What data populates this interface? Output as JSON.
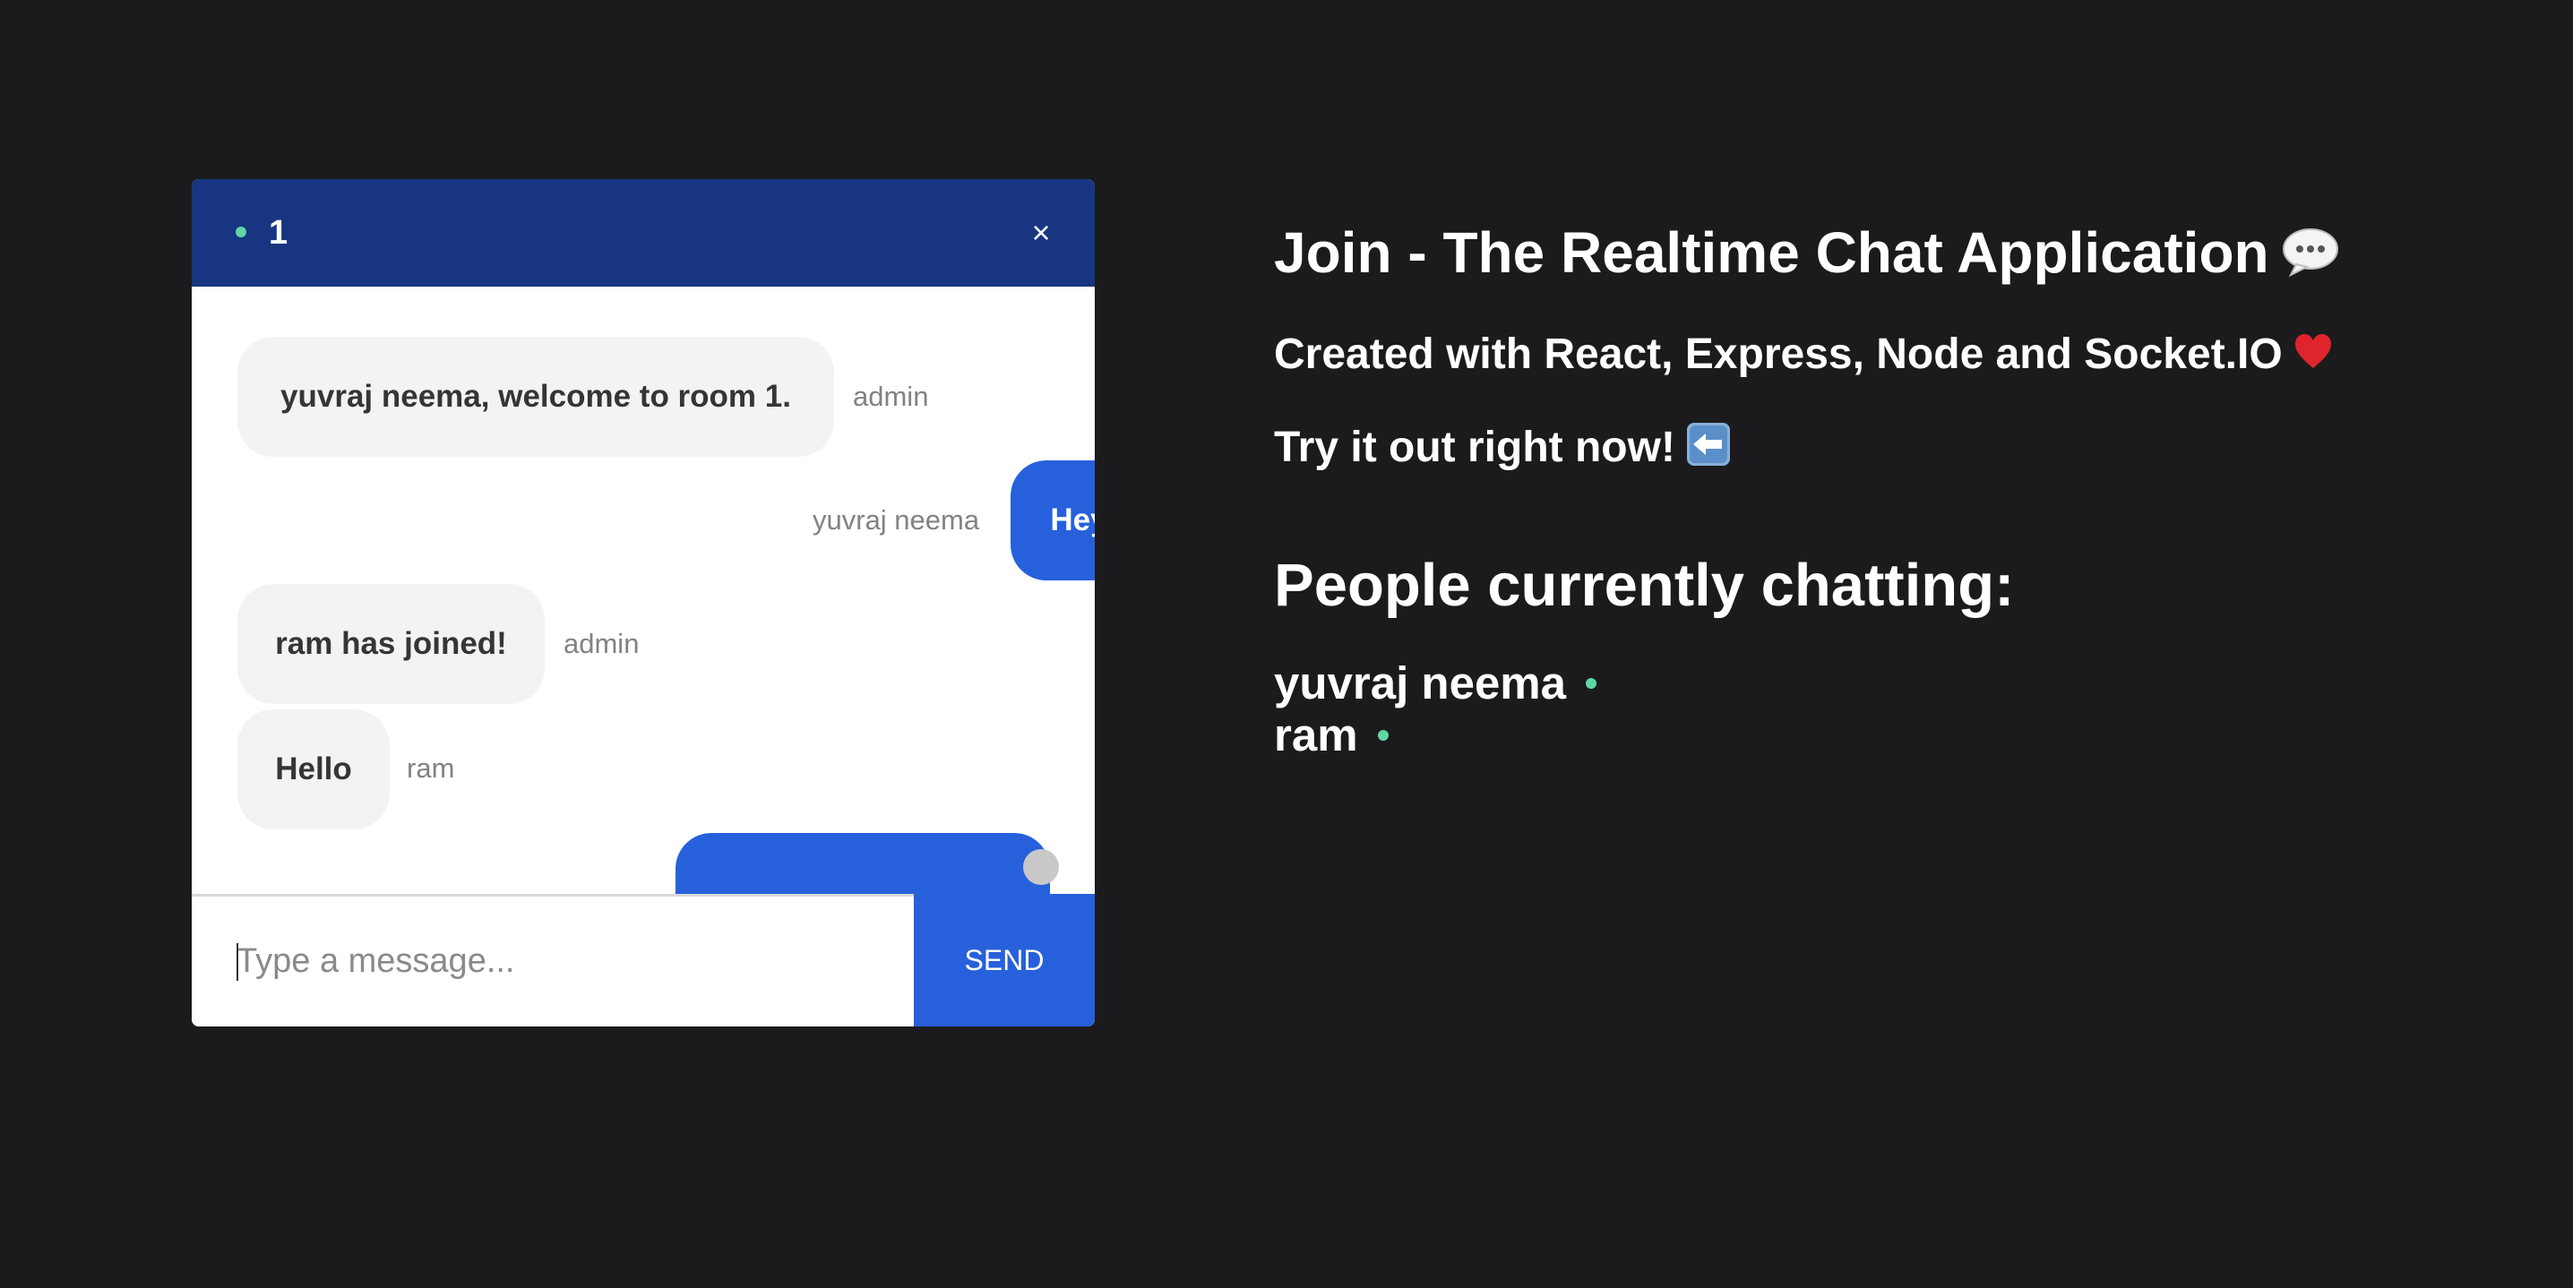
{
  "chat": {
    "room": "1",
    "close_glyph": "×",
    "messages": [
      {
        "text": "yuvraj neema, welcome to room 1.",
        "sender": "admin",
        "type": "received"
      },
      {
        "text": "Hey There",
        "sender": "yuvraj neema",
        "type": "sent"
      },
      {
        "text": "ram has joined!",
        "sender": "admin",
        "type": "received"
      },
      {
        "text": "Hello",
        "sender": "ram",
        "type": "received"
      }
    ],
    "input_placeholder": "Type a message...",
    "send_label": "SEND"
  },
  "info": {
    "title": "Join - The Realtime Chat Application",
    "subtitle": "Created with React, Express, Node and Socket.IO",
    "cta": "Try it out right now!",
    "people_heading": "People currently chatting:",
    "people": [
      "yuvraj neema",
      "ram"
    ]
  },
  "icons": {
    "title_emoji": "speech-balloon-icon",
    "subtitle_emoji": "red-heart-icon",
    "cta_emoji": "left-arrow-icon",
    "online_indicator": "online-dot-icon"
  },
  "colors": {
    "background": "#1b1b1d",
    "header": "#173580",
    "accent": "#2760db",
    "received_bubble": "#f3f3f3",
    "online": "#5fd7a4"
  }
}
